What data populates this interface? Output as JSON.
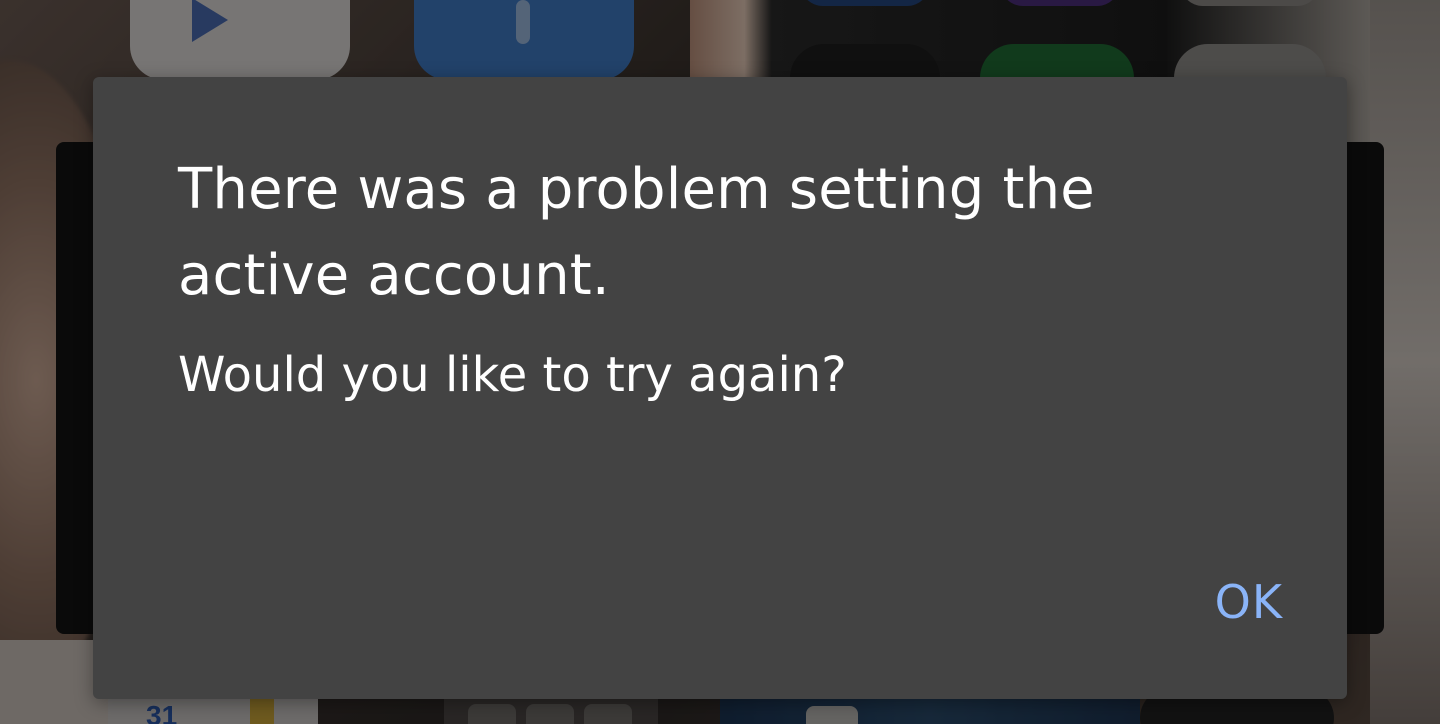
{
  "dialog": {
    "title": "There was a problem setting the active account.",
    "message": "Would you like to try again?",
    "ok_label": "OK"
  },
  "background": {
    "calendar_icon_text": "31"
  },
  "colors": {
    "dialog_background": "#434343",
    "dialog_text": "#ffffff",
    "accent": "#8ab4f8",
    "scrim": "rgba(0,0,0,0.45)"
  },
  "icons": [
    "play-store-icon",
    "app-icon",
    "calendar-icon",
    "photos-icon"
  ]
}
